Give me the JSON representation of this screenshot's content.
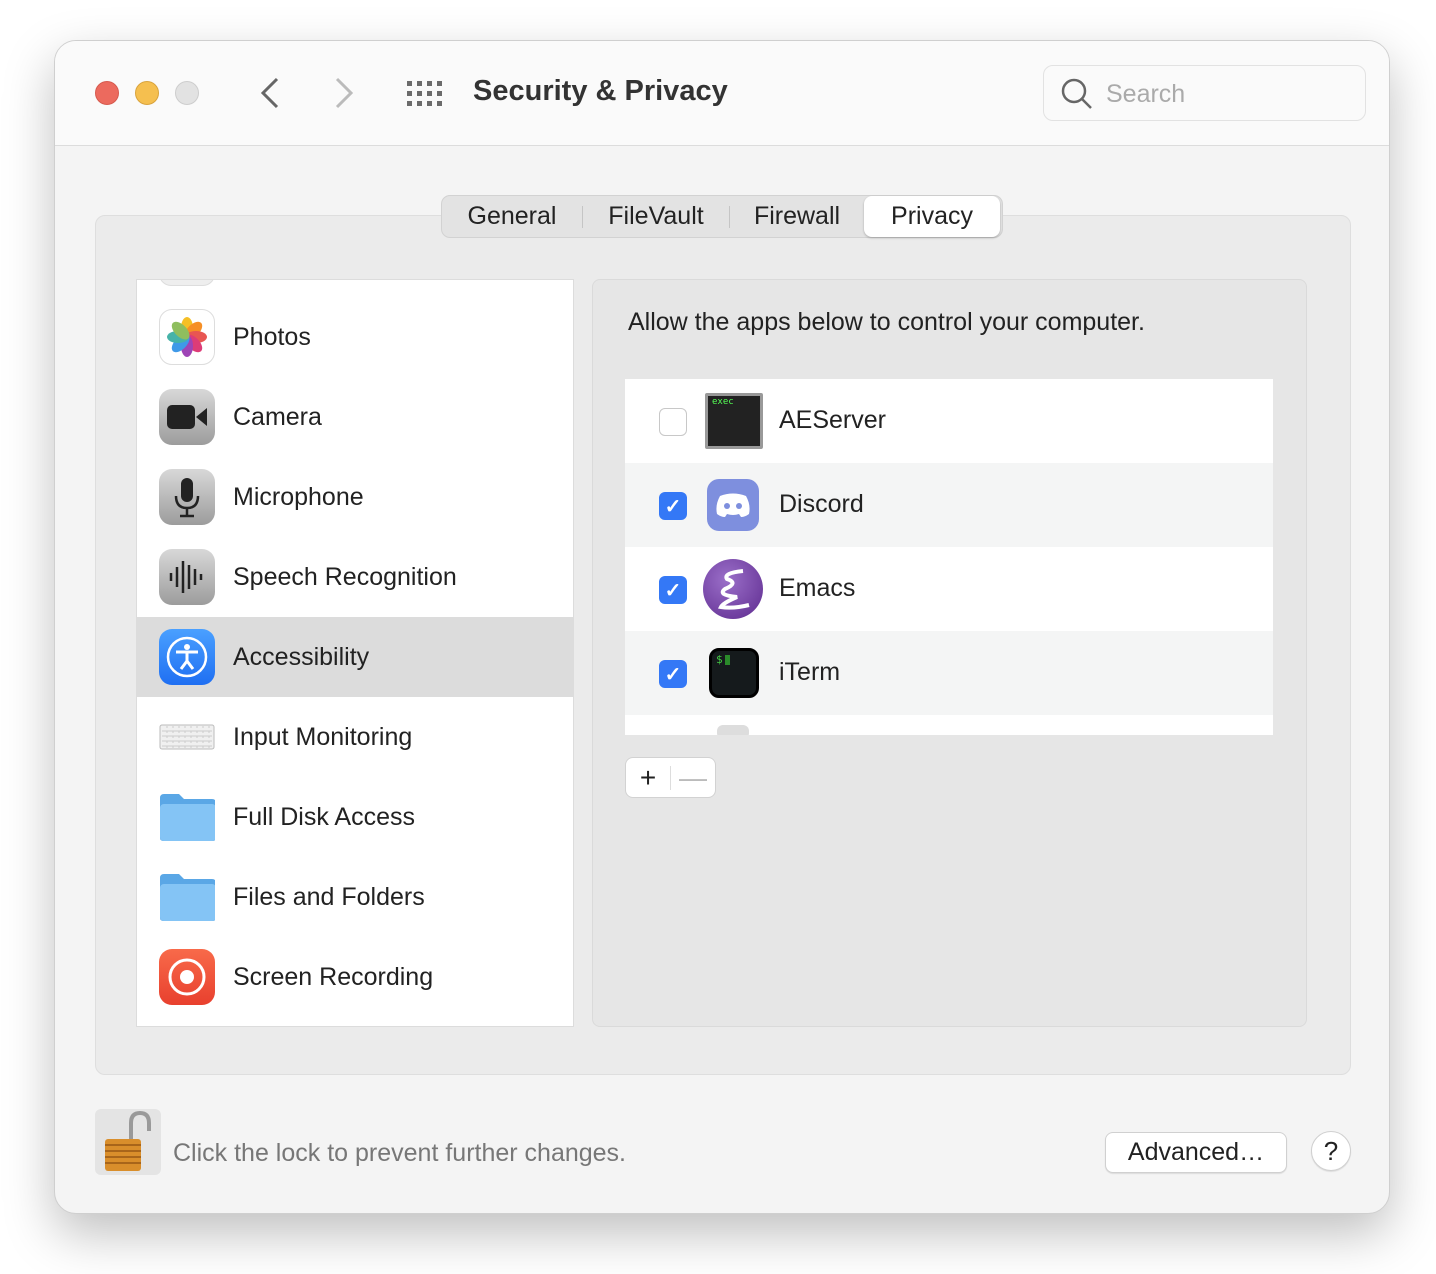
{
  "window": {
    "title": "Security & Privacy",
    "search_placeholder": "Search"
  },
  "tabs": [
    {
      "label": "General"
    },
    {
      "label": "FileVault"
    },
    {
      "label": "Firewall"
    },
    {
      "label": "Privacy",
      "selected": true
    }
  ],
  "sidebar": {
    "items": [
      {
        "label": "Photos",
        "icon": "photos-icon"
      },
      {
        "label": "Camera",
        "icon": "camera-icon"
      },
      {
        "label": "Microphone",
        "icon": "microphone-icon"
      },
      {
        "label": "Speech Recognition",
        "icon": "speech-recognition-icon"
      },
      {
        "label": "Accessibility",
        "icon": "accessibility-icon",
        "selected": true
      },
      {
        "label": "Input Monitoring",
        "icon": "keyboard-icon"
      },
      {
        "label": "Full Disk Access",
        "icon": "folder-icon"
      },
      {
        "label": "Files and Folders",
        "icon": "folder-icon"
      },
      {
        "label": "Screen Recording",
        "icon": "screen-recording-icon"
      }
    ]
  },
  "main": {
    "description": "Allow the apps below to control your computer.",
    "apps": [
      {
        "name": "AEServer",
        "checked": false,
        "icon_text": "exec"
      },
      {
        "name": "Discord",
        "checked": true
      },
      {
        "name": "Emacs",
        "checked": true
      },
      {
        "name": "iTerm",
        "checked": true,
        "icon_text": "$"
      }
    ],
    "add_label": "+",
    "remove_label": "—"
  },
  "footer": {
    "lock_text": "Click the lock to prevent further changes.",
    "advanced_label": "Advanced…",
    "help_label": "?"
  },
  "colors": {
    "accent": "#3478f6",
    "close": "#ec6a5e",
    "minimize": "#f5bf4f",
    "selection": "#dcdcdc"
  }
}
